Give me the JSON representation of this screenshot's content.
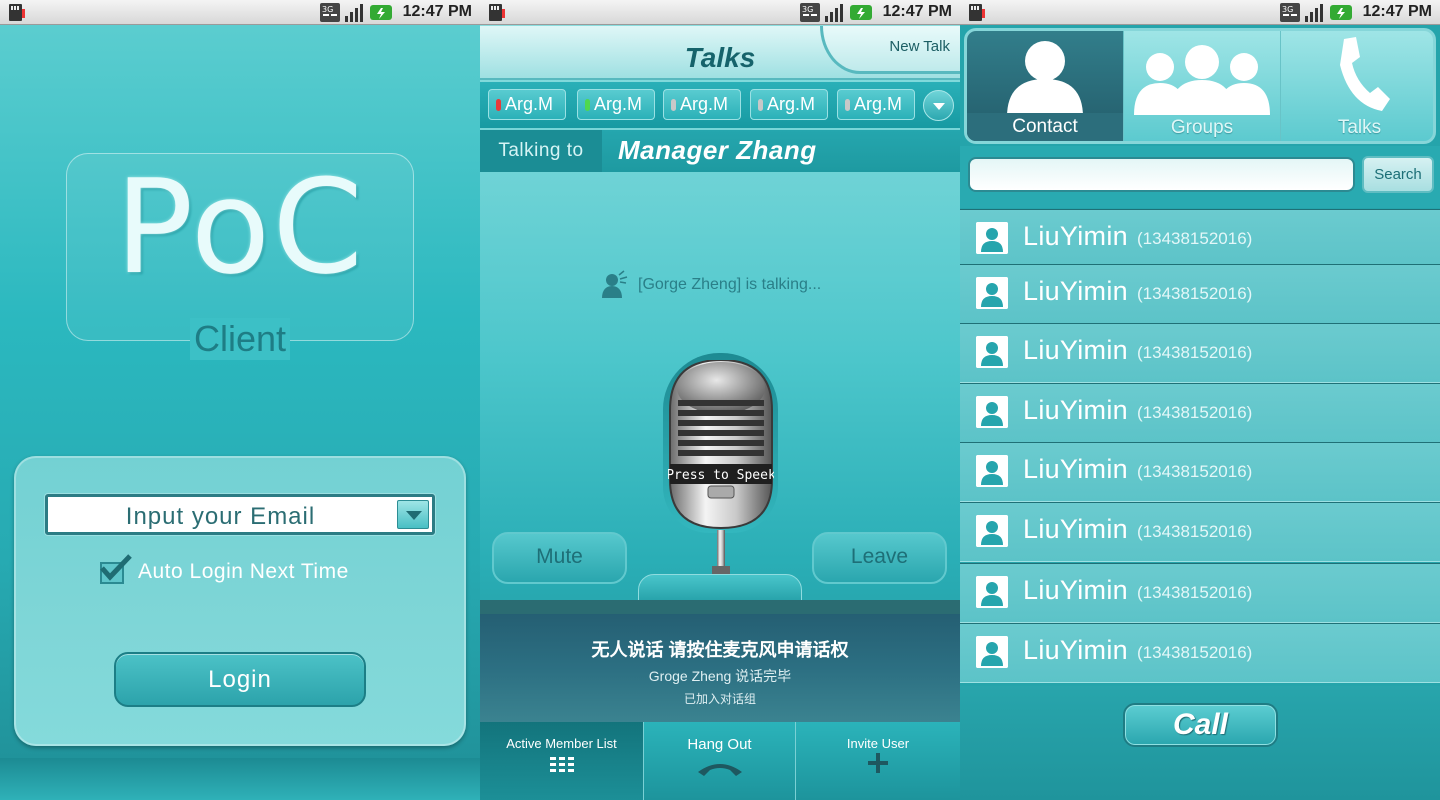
{
  "status_bar": {
    "time": "12:47 PM",
    "network": "3G"
  },
  "login_screen": {
    "logo_main": "PoC",
    "logo_sub": "Client",
    "email_placeholder": "Input your Email",
    "auto_login_label": "Auto Login Next Time",
    "auto_login_checked": true,
    "login_button": "Login"
  },
  "talks_screen": {
    "title": "Talks",
    "new_talk": "New Talk",
    "tabs": [
      {
        "label": "Arg.M",
        "indicator_color": "#e63b3b"
      },
      {
        "label": "Arg.M",
        "indicator_color": "#4fd84f"
      },
      {
        "label": "Arg.M",
        "indicator_color": "#c8c8c8"
      },
      {
        "label": "Arg.M",
        "indicator_color": "#c8c8c8"
      },
      {
        "label": "Arg.M",
        "indicator_color": "#c8c8c8"
      }
    ],
    "talking_to_label": "Talking to",
    "talking_to_name": "Manager Zhang",
    "talking_status": "[Gorge Zheng] is talking...",
    "mic_label": "Press to Speek",
    "mute_button": "Mute",
    "leave_button": "Leave",
    "info_line_1": "无人说话 请按住麦克风申请话权",
    "info_line_2": "Groge Zheng 说话完毕",
    "info_line_3": "已加入对话组",
    "bottom_buttons": [
      {
        "label": "Active Member List",
        "icon": "list-icon"
      },
      {
        "label": "Hang Out",
        "icon": "phone-hangup-icon"
      },
      {
        "label": "Invite User",
        "icon": "plus-icon"
      }
    ]
  },
  "contacts_screen": {
    "tabs": [
      {
        "label": "Contact",
        "icon": "person-icon"
      },
      {
        "label": "Groups",
        "icon": "group-icon"
      },
      {
        "label": "Talks",
        "icon": "phone-icon"
      }
    ],
    "search_button": "Search",
    "contacts": [
      {
        "name": "LiuYimin",
        "phone": "(13438152016)"
      },
      {
        "name": "LiuYimin",
        "phone": "(13438152016)"
      },
      {
        "name": "LiuYimin",
        "phone": "(13438152016)"
      },
      {
        "name": "LiuYimin",
        "phone": "(13438152016)"
      },
      {
        "name": "LiuYimin",
        "phone": "(13438152016)"
      },
      {
        "name": "LiuYimin",
        "phone": "(13438152016)"
      },
      {
        "name": "LiuYimin",
        "phone": "(13438152016)"
      },
      {
        "name": "LiuYimin",
        "phone": "(13438152016)"
      }
    ],
    "call_button": "Call"
  },
  "colors": {
    "accent": "#2bb8bf",
    "dark_teal": "#1b8d95",
    "deep_panel": "#2c6f82"
  }
}
